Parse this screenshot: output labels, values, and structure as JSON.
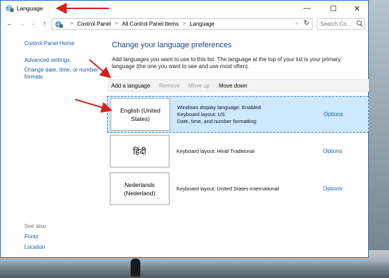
{
  "window": {
    "title": "Language",
    "controls": {
      "minimize": "—",
      "maximize": "☐",
      "close": "✕"
    }
  },
  "nav": {
    "back": "←",
    "forward": "→",
    "recent": "⌄",
    "up": "↑",
    "breadcrumbs": [
      "Control Panel",
      "All Control Panel Items",
      "Language"
    ],
    "search_placeholder": "Search Co..."
  },
  "sidebar": {
    "home": "Control Panel Home",
    "advanced": "Advanced settings",
    "date_time": "Change date, time, or number formats",
    "see_also": "See also",
    "fonts": "Fonts",
    "location": "Location"
  },
  "main": {
    "heading": "Change your language preferences",
    "description": "Add languages you want to use to this list. The language at the top of your list is your primary language (the one you want to see and use most often).",
    "toolbar": {
      "add": "Add a language",
      "remove": "Remove",
      "move_up": "Move up",
      "move_down": "Move down"
    },
    "languages": [
      {
        "name": "English (United States)",
        "details": [
          "Windows display language: Enabled",
          "Keyboard layout: US",
          "Date, time, and number formatting"
        ],
        "options": "Options"
      },
      {
        "name": "हिंदी",
        "details": [
          "Keyboard layout: Hindi Traditional"
        ],
        "options": "Options"
      },
      {
        "name": "Nederlands (Nederland)",
        "details": [
          "Keyboard layout: United States-International"
        ],
        "options": "Options"
      }
    ]
  },
  "colors": {
    "accent": "#1b5fa8",
    "heading": "#1e3f87",
    "selection": "#cde8ff",
    "arrow": "#d42020"
  }
}
